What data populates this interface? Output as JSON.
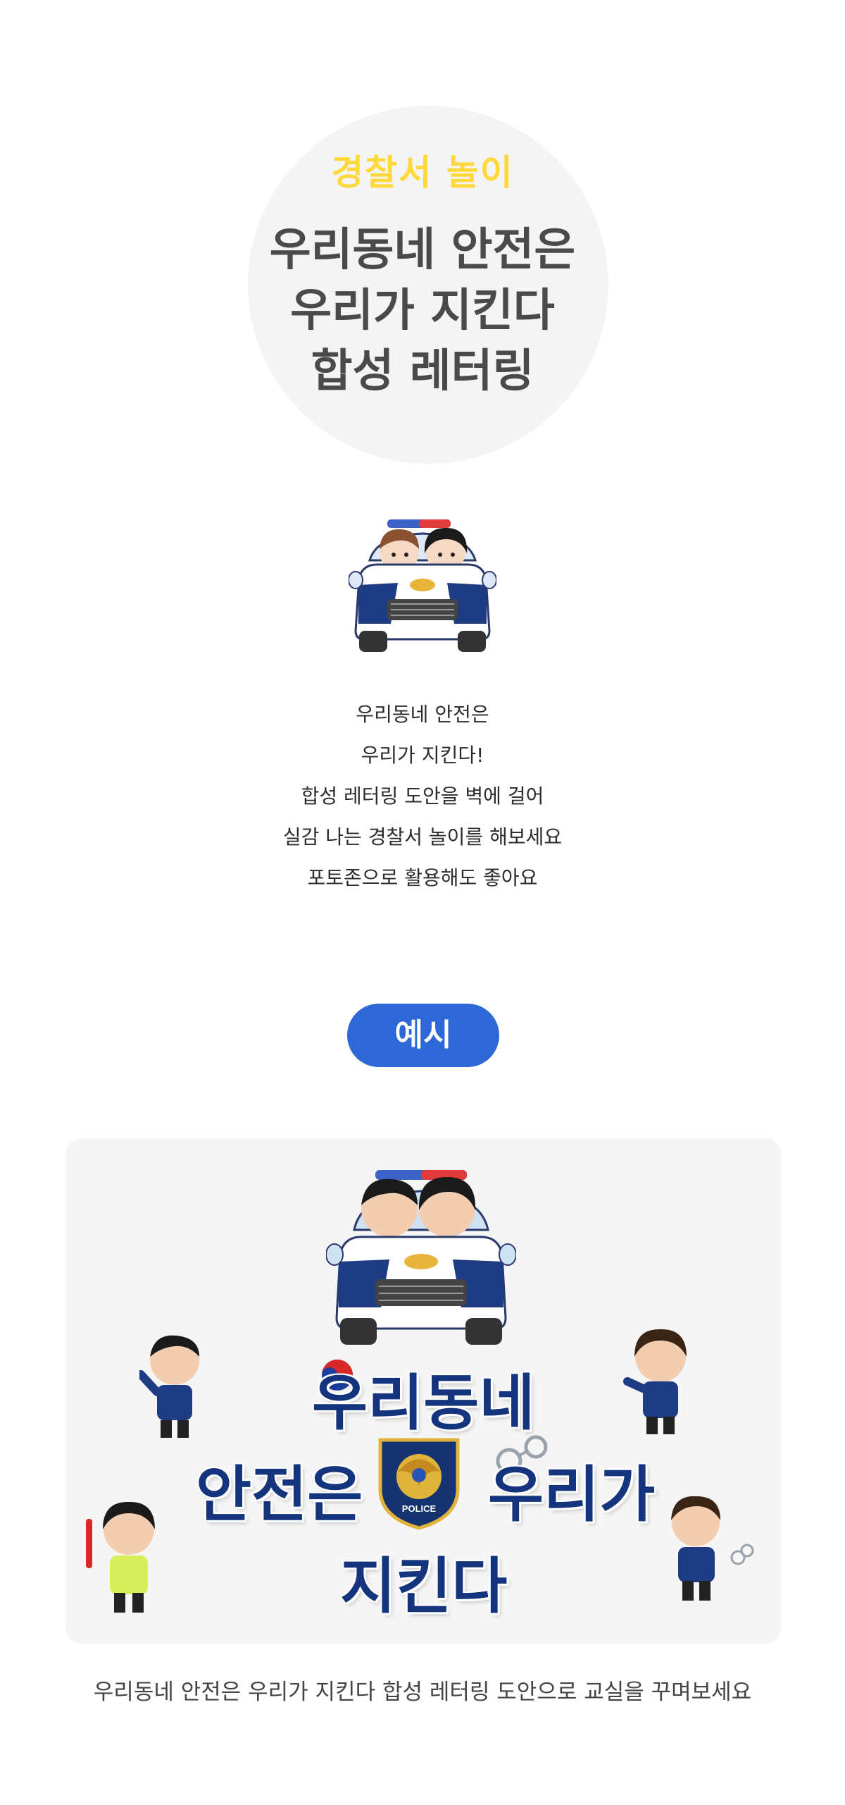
{
  "hero": {
    "subtitle": "경찰서 놀이",
    "title_line1": "우리동네 안전은",
    "title_line2": "우리가 지킨다",
    "title_line3": "합성 레터링"
  },
  "description": {
    "line1": "우리동네 안전은",
    "line2": "우리가 지킨다!",
    "line3": "합성 레터링 도안을 벽에 걸어",
    "line4": "실감 나는 경찰서 놀이를 해보세요",
    "line5": "포토존으로 활용해도 좋아요"
  },
  "example_button": {
    "label": "예시"
  },
  "example": {
    "lettering_line1": "우리동네",
    "lettering_line2a": "안전은",
    "lettering_line2b": "우리가",
    "lettering_line3": "지킨다",
    "badge_text": "POLICE"
  },
  "caption": "우리동네 안전은 우리가 지킨다 합성 레터링 도안으로 교실을 꾸며보세요",
  "colors": {
    "accent_yellow": "#ffd83a",
    "button_blue": "#2e67d6",
    "lettering_navy": "#14357e",
    "card_bg": "#f5f5f5"
  }
}
